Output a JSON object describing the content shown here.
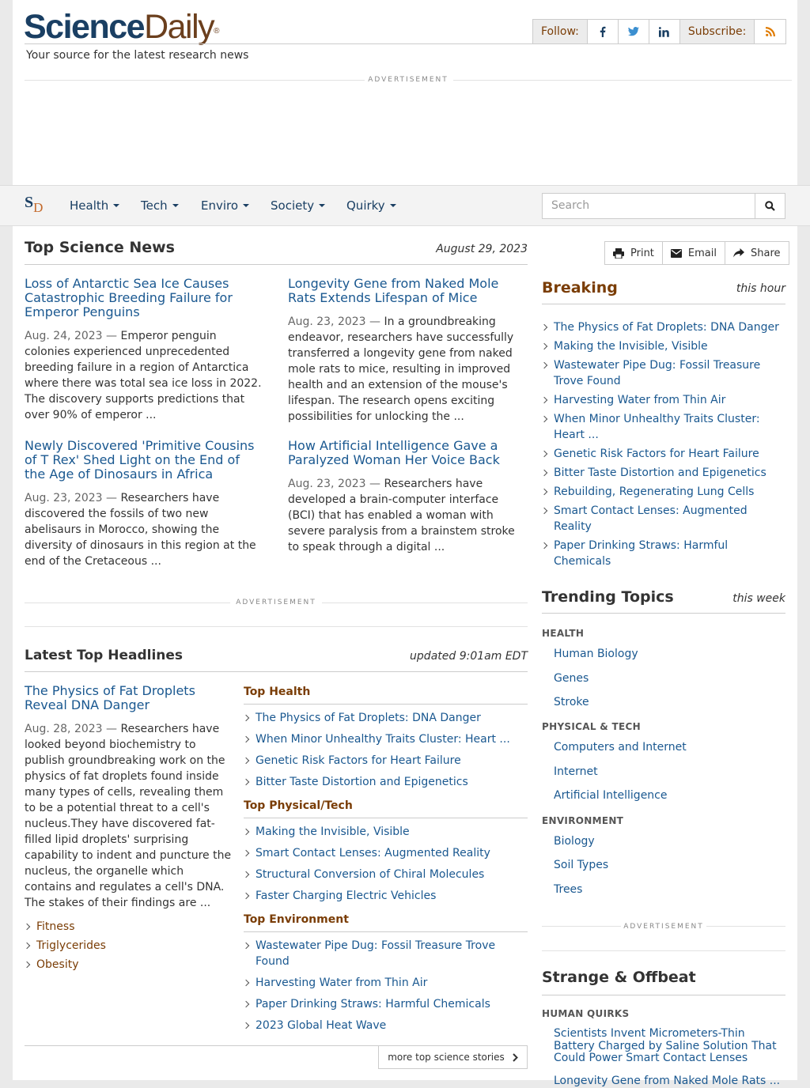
{
  "header": {
    "logo_primary": "Science",
    "logo_secondary": "Daily",
    "logo_reg": "®",
    "tagline": "Your source for the latest research news",
    "follow_label": "Follow:",
    "subscribe_label": "Subscribe:",
    "ad_label": "ADVERTISEMENT"
  },
  "nav": {
    "logo_s": "S",
    "logo_d": "D",
    "items": [
      {
        "label": "Health"
      },
      {
        "label": "Tech"
      },
      {
        "label": "Enviro"
      },
      {
        "label": "Society"
      },
      {
        "label": "Quirky"
      }
    ],
    "search_placeholder": "Search"
  },
  "top_news": {
    "title": "Top Science News",
    "date": "August 29, 2023",
    "stories": [
      {
        "title": "Loss of Antarctic Sea Ice Causes Catastrophic Breeding Failure for Emperor Penguins",
        "date": "Aug. 24, 2023",
        "summary": "Emperor penguin colonies experienced unprecedented breeding failure in a region of Antarctica where there was total sea ice loss in 2022. The discovery supports predictions that over 90% of emperor ..."
      },
      {
        "title": "Longevity Gene from Naked Mole Rats Extends Lifespan of Mice",
        "date": "Aug. 23, 2023",
        "summary": "In a groundbreaking endeavor, researchers have successfully transferred a longevity gene from naked mole rats to mice, resulting in improved health and an extension of the mouse's lifespan. The research opens exciting possibilities for unlocking the ..."
      },
      {
        "title": "Newly Discovered 'Primitive Cousins of T Rex' Shed Light on the End of the Age of Dinosaurs in Africa",
        "date": "Aug. 23, 2023",
        "summary": "Researchers have discovered the fossils of two new abelisaurs in Morocco, showing the diversity of dinosaurs in this region at the end of the Cretaceous ..."
      },
      {
        "title": "How Artificial Intelligence Gave a Paralyzed Woman Her Voice Back",
        "date": "Aug. 23, 2023",
        "summary": "Researchers have developed a brain-computer interface (BCI) that has enabled a woman with severe paralysis from a brainstem stroke to speak through a digital ..."
      }
    ]
  },
  "latest": {
    "title": "Latest Top Headlines",
    "updated": "updated 9:01am EDT",
    "feature": {
      "title": "The Physics of Fat Droplets Reveal DNA Danger",
      "date": "Aug. 28, 2023",
      "summary": "Researchers have looked beyond biochemistry to publish groundbreaking work on the physics of fat droplets found inside many types of cells, revealing them to be a potential threat to a cell's nucleus.They have discovered fat-filled lipid droplets' surprising capability to indent and puncture the nucleus, the organelle which contains and regulates a cell's DNA. The stakes of their findings are ...",
      "tags": [
        "Fitness",
        "Triglycerides",
        "Obesity"
      ]
    },
    "top_health": {
      "label": "Top Health",
      "items": [
        "The Physics of Fat Droplets: DNA Danger",
        "When Minor Unhealthy Traits Cluster: Heart ...",
        "Genetic Risk Factors for Heart Failure",
        "Bitter Taste Distortion and Epigenetics"
      ]
    },
    "top_physical": {
      "label": "Top Physical/Tech",
      "items": [
        "Making the Invisible, Visible",
        "Smart Contact Lenses: Augmented Reality",
        "Structural Conversion of Chiral Molecules",
        "Faster Charging Electric Vehicles"
      ]
    },
    "top_env": {
      "label": "Top Environment",
      "items": [
        "Wastewater Pipe Dug: Fossil Treasure Trove Found",
        "Harvesting Water from Thin Air",
        "Paper Drinking Straws: Harmful Chemicals",
        "2023 Global Heat Wave"
      ]
    },
    "more_label": "more top science stories"
  },
  "actions": {
    "print": "Print",
    "email": "Email",
    "share": "Share"
  },
  "breaking": {
    "title": "Breaking",
    "when": "this hour",
    "items": [
      "The Physics of Fat Droplets: DNA Danger",
      "Making the Invisible, Visible",
      "Wastewater Pipe Dug: Fossil Treasure Trove Found",
      "Harvesting Water from Thin Air",
      "When Minor Unhealthy Traits Cluster: Heart ...",
      "Genetic Risk Factors for Heart Failure",
      "Bitter Taste Distortion and Epigenetics",
      "Rebuilding, Regenerating Lung Cells",
      "Smart Contact Lenses: Augmented Reality",
      "Paper Drinking Straws: Harmful Chemicals"
    ]
  },
  "trending": {
    "title": "Trending Topics",
    "when": "this week",
    "groups": [
      {
        "label": "HEALTH",
        "topics": [
          "Human Biology",
          "Genes",
          "Stroke"
        ]
      },
      {
        "label": "PHYSICAL & TECH",
        "topics": [
          "Computers and Internet",
          "Internet",
          "Artificial Intelligence"
        ]
      },
      {
        "label": "ENVIRONMENT",
        "topics": [
          "Biology",
          "Soil Types",
          "Trees"
        ]
      }
    ]
  },
  "offbeat": {
    "title": "Strange & Offbeat",
    "group": "HUMAN QUIRKS",
    "items": [
      "Scientists Invent Micrometers-Thin Battery Charged by Saline Solution That Could Power Smart Contact Lenses",
      "Longevity Gene from Naked Mole Rats ..."
    ]
  }
}
